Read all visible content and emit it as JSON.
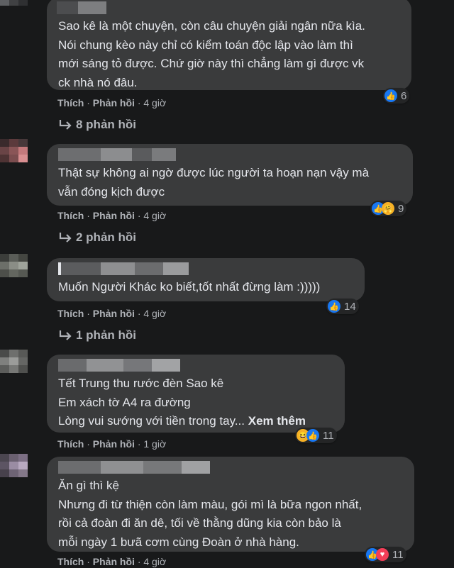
{
  "comments": [
    {
      "lines": [
        "Sao kê là một chuyện, còn câu chuyện giải ngân nữa kìa.",
        "Nói chung kèo này chỉ có kiểm toán độc lập vào làm thì",
        "mới sáng tỏ được. Chứ giờ này thì chẳng làm gì được vk",
        "ck nhà nó đâu."
      ],
      "like": "Thích",
      "reply": "Phản hồi",
      "sep": "·",
      "time": "4 giờ",
      "reaction_count": "6",
      "reactions": [
        "like-icon"
      ],
      "replies": "8 phản hồi"
    },
    {
      "lines": [
        "Thật sự không ai ngờ được lúc người ta hoạn nạn vậy mà",
        "vẫn đóng kịch được"
      ],
      "like": "Thích",
      "reply": "Phản hồi",
      "sep": "·",
      "time": "4 giờ",
      "reaction_count": "9",
      "reactions": [
        "like-icon",
        "care-icon"
      ],
      "replies": "2 phản hồi"
    },
    {
      "lines": [
        "Muốn Người Khác ko biết,tốt nhất đừng làm :)))))"
      ],
      "like": "Thích",
      "reply": "Phản hồi",
      "sep": "·",
      "time": "4 giờ",
      "reaction_count": "14",
      "reactions": [
        "like-icon"
      ],
      "replies": "1 phản hồi"
    },
    {
      "lines": [
        "Tết Trung thu rước đèn Sao kê",
        "Em xách tờ A4 ra đường",
        "Lòng vui sướng với tiền trong tay..."
      ],
      "see_more": "Xem thêm",
      "like": "Thích",
      "reply": "Phản hồi",
      "sep": "·",
      "time": "1 giờ",
      "reaction_count": "11",
      "reactions": [
        "haha-icon",
        "like-icon"
      ]
    },
    {
      "lines": [
        "Ăn gì thì kệ",
        "Nhưng đi từ thiện còn làm màu, gói mì là bữa ngon nhất,",
        "rồi cả đoàn đi ăn dê, tối về thằng dũng kia còn bảo là",
        "mỗi ngày 1 bưã cơm cùng Đoàn ở nhà hàng."
      ],
      "like": "Thích",
      "reply": "Phản hồi",
      "sep": "·",
      "time": "4 giờ",
      "reaction_count": "11",
      "reactions": [
        "like-icon",
        "love-icon"
      ]
    }
  ],
  "colors": {
    "background": "#18191a",
    "bubble": "#3a3b3c",
    "text": "#e4e6eb",
    "meta": "#b0b3b8",
    "like": "#1877f2",
    "love": "#f33e58",
    "haha": "#f7b125"
  }
}
